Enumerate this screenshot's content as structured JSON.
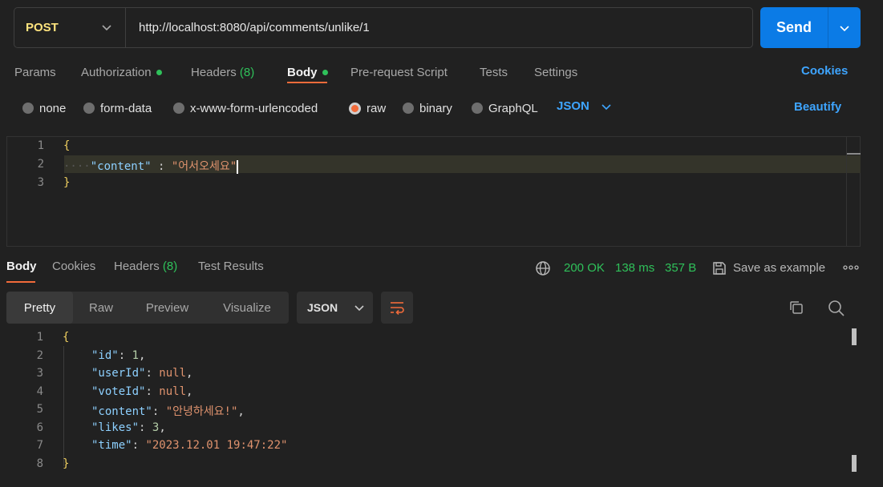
{
  "request": {
    "method": "POST",
    "url": "http://localhost:8080/api/comments/unlike/1",
    "send_label": "Send"
  },
  "request_tabs": {
    "params": "Params",
    "authorization": "Authorization",
    "headers": "Headers",
    "headers_count": "(8)",
    "body": "Body",
    "prerequest": "Pre-request Script",
    "tests": "Tests",
    "settings": "Settings",
    "cookies": "Cookies"
  },
  "body_types": {
    "none": "none",
    "form_data": "form-data",
    "urlencoded": "x-www-form-urlencoded",
    "raw": "raw",
    "binary": "binary",
    "graphql": "GraphQL",
    "format": "JSON",
    "beautify": "Beautify",
    "selected": "raw"
  },
  "request_body": {
    "line_numbers": [
      "1",
      "2",
      "3"
    ],
    "open_brace": "{",
    "key": "\"content\"",
    "separator": " : ",
    "value": "\"어서오세요\"",
    "close_brace": "}"
  },
  "response_tabs": {
    "body": "Body",
    "cookies": "Cookies",
    "headers": "Headers",
    "headers_count": "(8)",
    "test_results": "Test Results"
  },
  "response_status": {
    "code": "200 OK",
    "time": "138 ms",
    "size": "357 B",
    "save_as_example": "Save as example"
  },
  "response_view": {
    "pretty": "Pretty",
    "raw": "Raw",
    "preview": "Preview",
    "visualize": "Visualize",
    "format": "JSON",
    "active": "Pretty"
  },
  "response_body": {
    "line_numbers": [
      "1",
      "2",
      "3",
      "4",
      "5",
      "6",
      "7",
      "8"
    ],
    "open_brace": "{",
    "fields": [
      {
        "key": "\"id\"",
        "value": "1",
        "kind": "num",
        "comma": ","
      },
      {
        "key": "\"userId\"",
        "value": "null",
        "kind": "nul",
        "comma": ","
      },
      {
        "key": "\"voteId\"",
        "value": "null",
        "kind": "nul",
        "comma": ","
      },
      {
        "key": "\"content\"",
        "value": "\"안녕하세요!\"",
        "kind": "str",
        "comma": ","
      },
      {
        "key": "\"likes\"",
        "value": "3",
        "kind": "num",
        "comma": ","
      },
      {
        "key": "\"time\"",
        "value": "\"2023.12.01 19:47:22\"",
        "kind": "str",
        "comma": ""
      }
    ],
    "close_brace": "}"
  },
  "icons": {
    "send_dropdown": "chevron-down-icon",
    "globe": "globe-icon",
    "save": "save-icon",
    "more": "more-icon",
    "wrap": "wrap-lines-icon",
    "copy": "copy-icon",
    "search": "search-icon"
  },
  "colors": {
    "accent": "#f26b3a",
    "send": "#0b7be6",
    "link": "#3ea5ff",
    "success": "#2fc15a",
    "method": "#ffe47e"
  }
}
